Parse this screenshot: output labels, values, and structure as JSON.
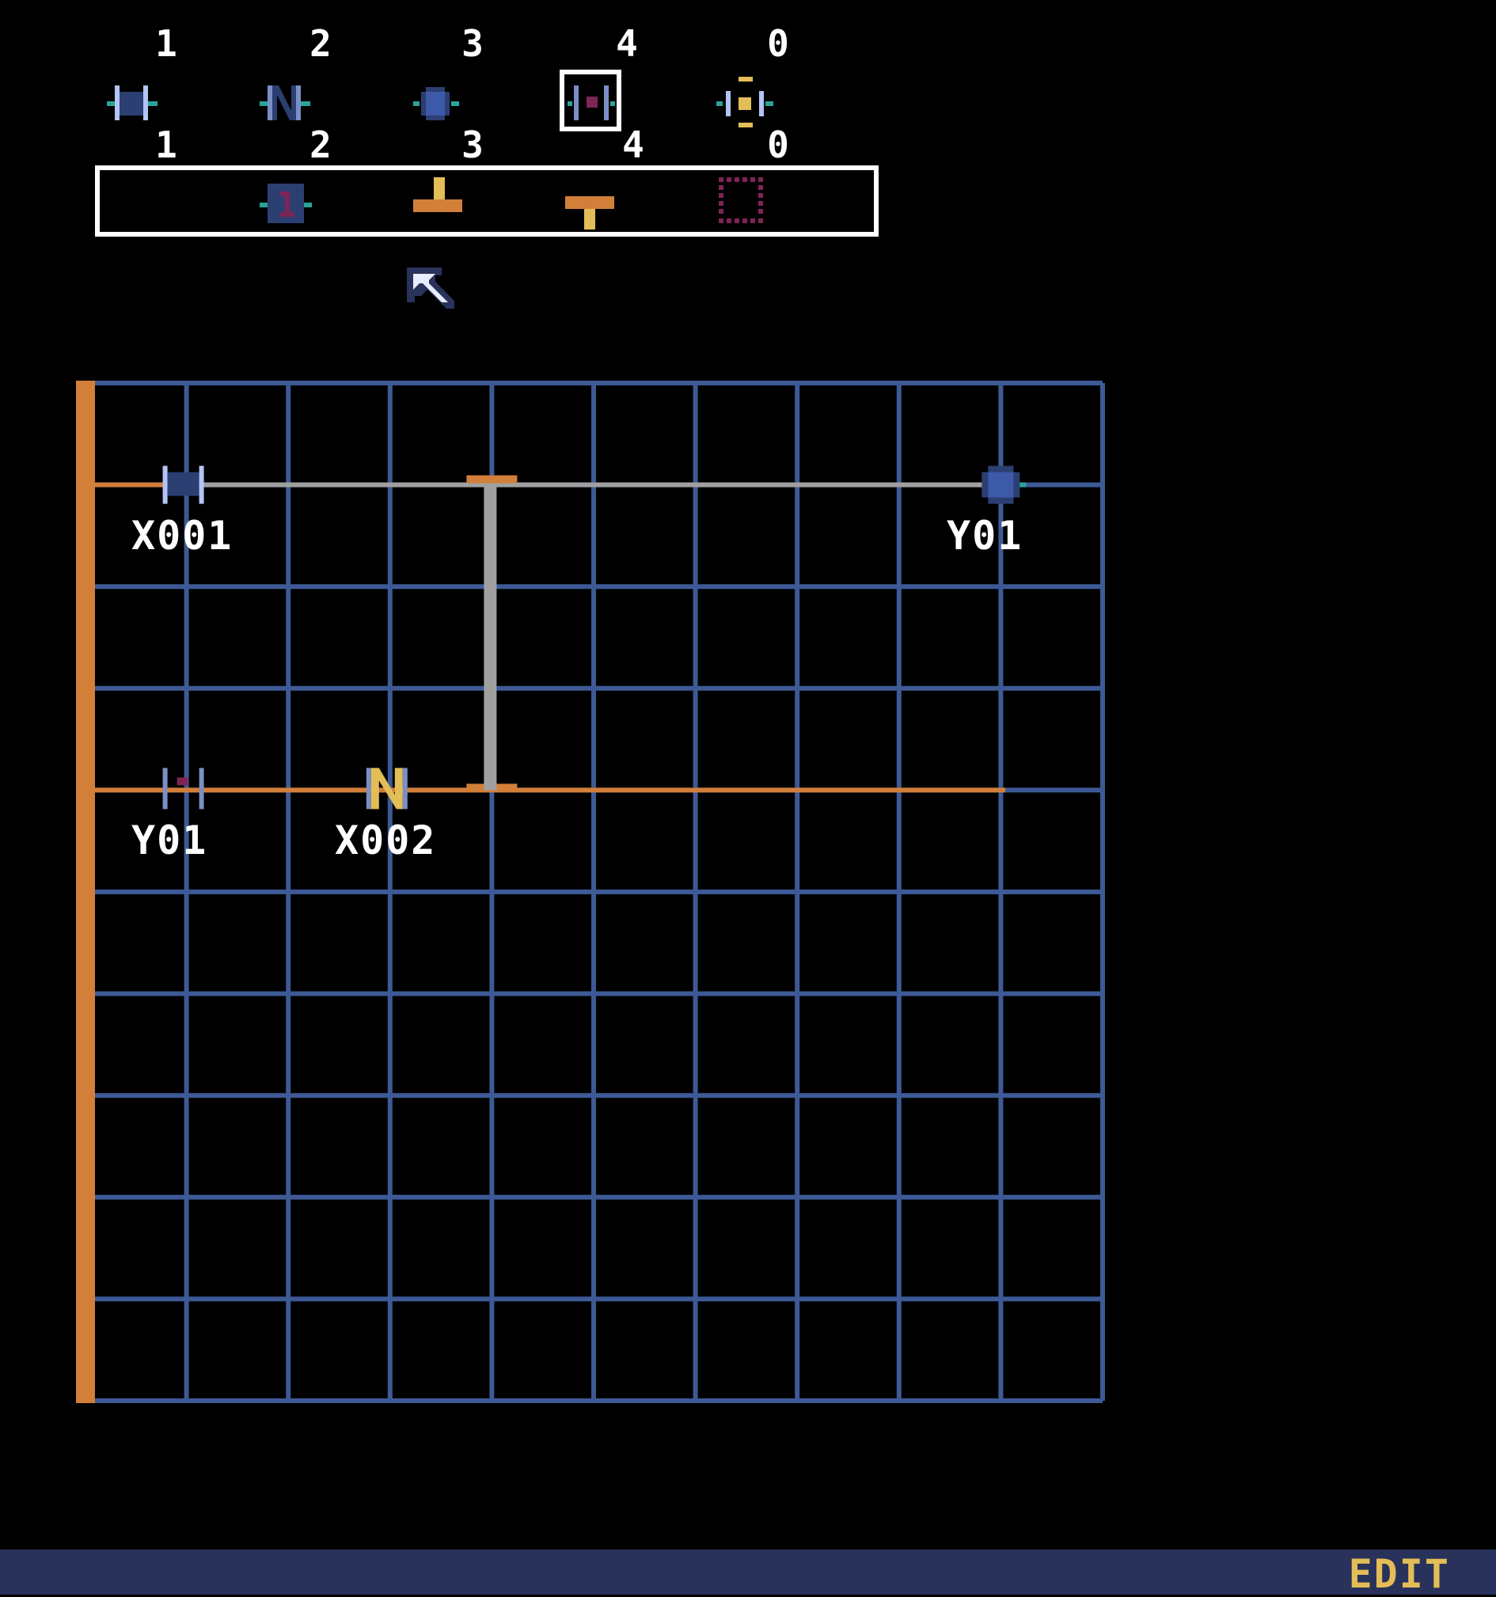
{
  "palette": {
    "top_counts": [
      "1",
      "2",
      "3",
      "4",
      "0"
    ],
    "bottom_counts": [
      "1",
      "2",
      "3",
      "4",
      "0"
    ],
    "icons": [
      "no-contact-icon",
      "nc-contact-icon",
      "coil-icon",
      "selected-contact-icon",
      "bracket-output-icon"
    ],
    "selected_index": 3
  },
  "toolbar": {
    "icons": [
      "counter-block-icon",
      "branch-up-icon",
      "branch-down-icon",
      "dotted-select-icon"
    ]
  },
  "ladder": {
    "rows": 10,
    "cols": 10,
    "elements": [
      {
        "label": "X001",
        "icon": "no-contact-icon"
      },
      {
        "label": "Y01",
        "icon": "coil-icon"
      },
      {
        "label": "Y01",
        "icon": "contact-icon"
      },
      {
        "label": "X002",
        "icon": "nc-contact-icon"
      }
    ]
  },
  "status": {
    "mode": "EDIT"
  },
  "colors": {
    "grid": "#3d5a96",
    "rail": "#d27f3a",
    "wire_active": "#d27f3a",
    "wire_inactive": "#a0a0a0",
    "status_bar": "#29325a",
    "mode_text": "#e3bd56"
  }
}
